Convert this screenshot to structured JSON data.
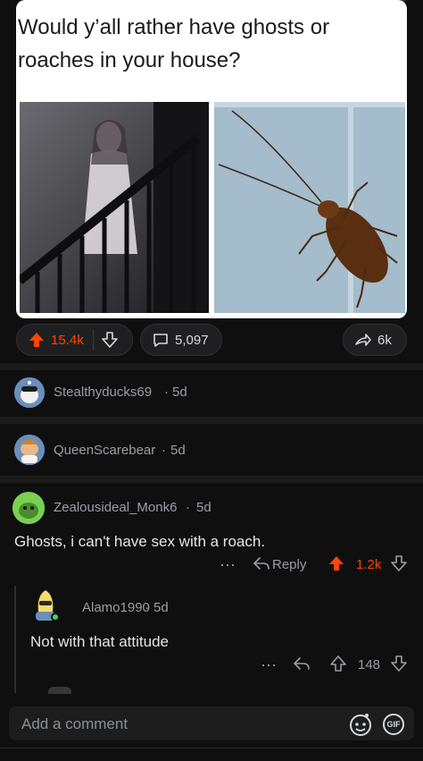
{
  "post": {
    "image_caption": "Would y’all rather have ghosts or roaches in your house?",
    "upvotes": "15.4k",
    "comments": "5,097",
    "shares": "6k"
  },
  "comments": [
    {
      "username": "Stealthyducks69",
      "age": "5d"
    },
    {
      "username": "QueenScarebear",
      "age": "5d"
    },
    {
      "username": "Zealousideal_Monk6",
      "age": "5d",
      "text": "Ghosts, i can't have sex with a roach.",
      "reply_label": "Reply",
      "score": "1.2k"
    },
    {
      "username": "Alamo1990",
      "age": "5d",
      "text": "Not with that attitude",
      "score": "148"
    }
  ],
  "composer": {
    "placeholder": "Add a comment",
    "gif_label": "GIF"
  },
  "colors": {
    "upvote": "#ff4500",
    "background": "#0f0f10"
  }
}
